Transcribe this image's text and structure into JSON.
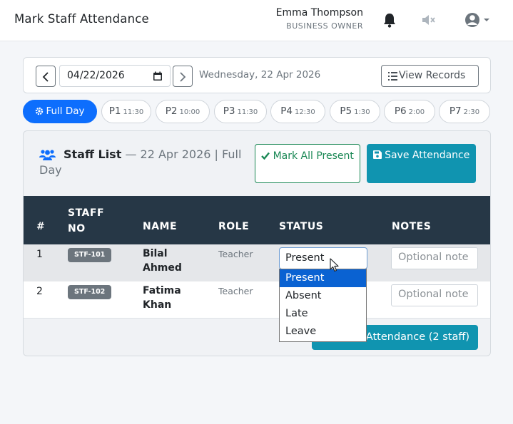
{
  "header": {
    "title": "Mark Staff Attendance",
    "user_name": "Emma Thompson",
    "user_role": "BUSINESS OWNER",
    "icons": [
      "bell-icon",
      "mute-icon",
      "user-avatar-icon"
    ]
  },
  "date_bar": {
    "date_value": "04/22/2026",
    "date_label": "Wednesday, 22 Apr 2026",
    "view_records": "View Records"
  },
  "periods": [
    {
      "label": "Full Day",
      "time": ""
    },
    {
      "label": "P1",
      "time": "11:30"
    },
    {
      "label": "P2",
      "time": "10:00"
    },
    {
      "label": "P3",
      "time": "11:30"
    },
    {
      "label": "P4",
      "time": "12:30"
    },
    {
      "label": "P5",
      "time": "1:30"
    },
    {
      "label": "P6",
      "time": "2:00"
    },
    {
      "label": "P7",
      "time": "2:30"
    }
  ],
  "staff_list": {
    "title": "Staff List",
    "subtitle": "— 22 Apr 2026 | Full Day",
    "mark_all": "Mark All Present",
    "save": "Save Attendance",
    "columns": {
      "num": "#",
      "staff_no": "STAFF NO",
      "name": "NAME",
      "role": "ROLE",
      "status": "STATUS",
      "notes": "NOTES"
    },
    "rows": [
      {
        "num": "1",
        "staff_no": "STF-101",
        "name": "Bilal Ahmed",
        "role": "Teacher",
        "status": "Present",
        "notes_placeholder": "Optional note"
      },
      {
        "num": "2",
        "staff_no": "STF-102",
        "name": "Fatima Khan",
        "role": "Teacher",
        "status": "Present",
        "notes_placeholder": "Optional note"
      }
    ],
    "submit": "Attendance (2 staff)"
  },
  "status_options": [
    "Present",
    "Absent",
    "Late",
    "Leave"
  ],
  "colors": {
    "primary": "#0d6efd",
    "info": "#1094b0",
    "success": "#198754",
    "table_header": "#263746"
  }
}
